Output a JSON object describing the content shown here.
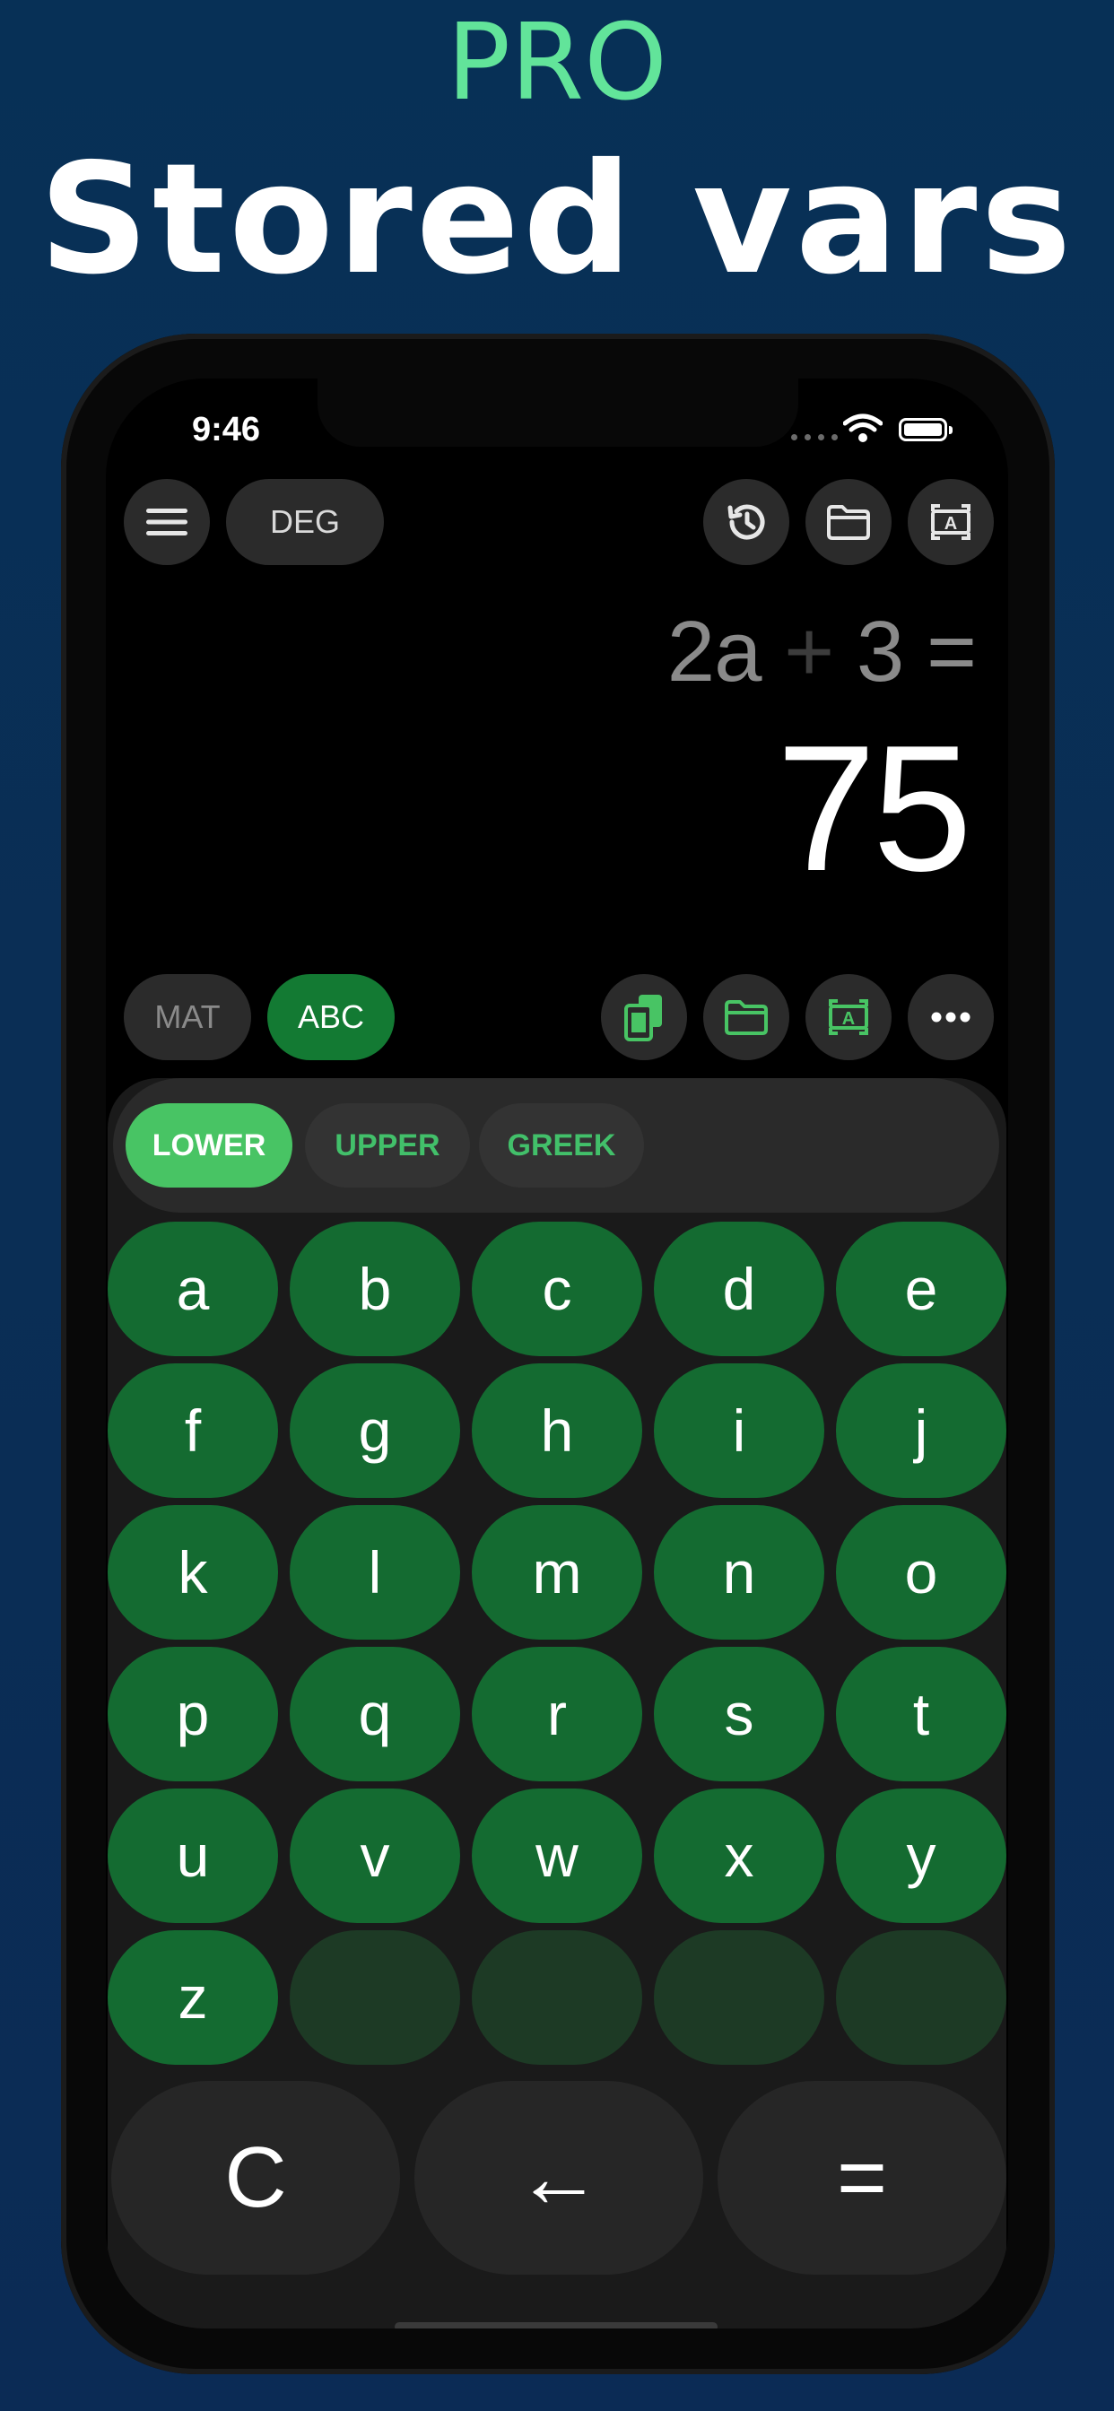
{
  "promo": {
    "badge": "PRO",
    "title": "Stored vars"
  },
  "status_bar": {
    "time": "9:46"
  },
  "top_bar": {
    "angle_mode": "DEG"
  },
  "display": {
    "expression": {
      "lhs": "2a",
      "op": "+",
      "rhs": "3",
      "eq": "="
    },
    "result": "75"
  },
  "mode_tabs": {
    "mat": "MAT",
    "abc": "ABC",
    "active": "ABC"
  },
  "letter_case_tabs": [
    {
      "label": "LOWER",
      "active": true
    },
    {
      "label": "UPPER",
      "active": false
    },
    {
      "label": "GREEK",
      "active": false
    }
  ],
  "keys": [
    "a",
    "b",
    "c",
    "d",
    "e",
    "f",
    "g",
    "h",
    "i",
    "j",
    "k",
    "l",
    "m",
    "n",
    "o",
    "p",
    "q",
    "r",
    "s",
    "t",
    "u",
    "v",
    "w",
    "x",
    "y",
    "z"
  ],
  "bottom_keys": {
    "clear": "C",
    "backspace": "←",
    "equals": "="
  },
  "colors": {
    "accent_green": "#62e49a",
    "key_green": "#146b31",
    "active_tab_green": "#48c464",
    "background": "#0a2e55"
  }
}
